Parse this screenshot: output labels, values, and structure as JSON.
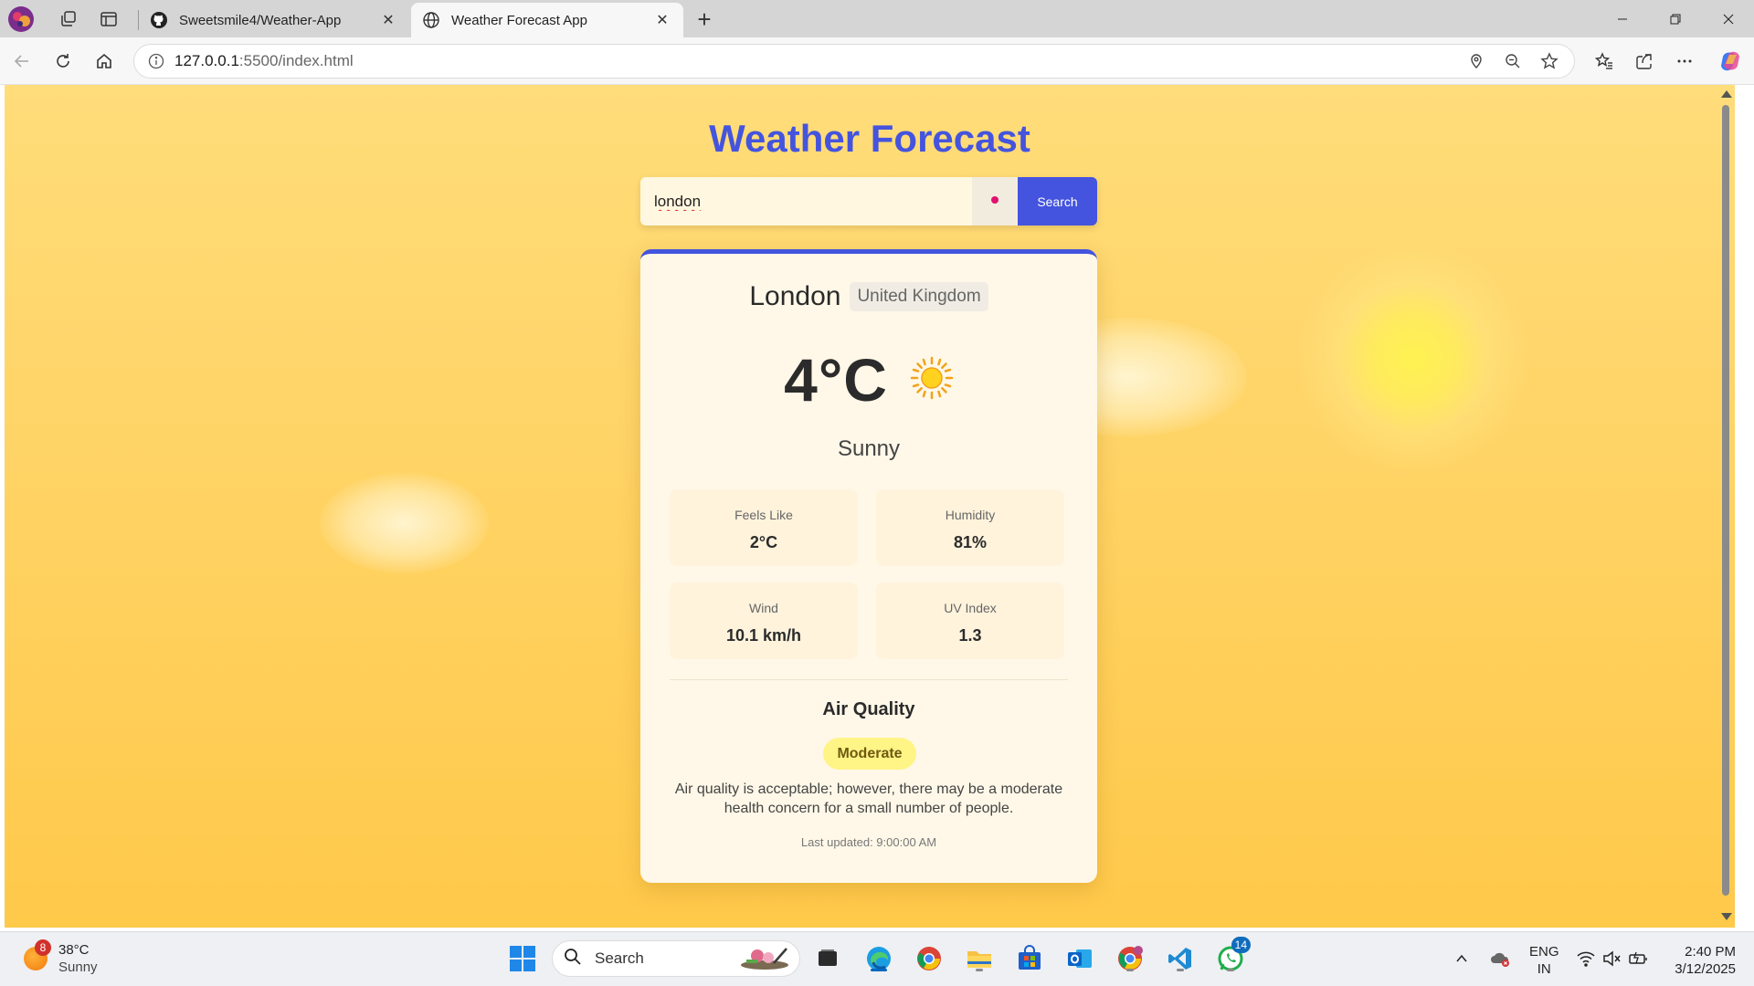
{
  "browser": {
    "tabs": [
      {
        "title": "Sweetsmile4/Weather-App",
        "icon": "github-icon"
      },
      {
        "title": "Weather Forecast App",
        "icon": "globe-icon"
      }
    ],
    "address": {
      "host": "127.0.0.1",
      "path": ":5500/index.html"
    }
  },
  "page": {
    "app_title": "Weather Forecast",
    "search": {
      "value": "london",
      "button_label": "Search"
    },
    "weather": {
      "city": "London",
      "country": "United Kingdom",
      "temperature": "4°C",
      "condition": "Sunny",
      "icon": "sun-icon",
      "stats": [
        {
          "label": "Feels Like",
          "value": "2°C"
        },
        {
          "label": "Humidity",
          "value": "81%"
        },
        {
          "label": "Wind",
          "value": "10.1 km/h"
        },
        {
          "label": "UV Index",
          "value": "1.3"
        }
      ],
      "air_quality": {
        "title": "Air Quality",
        "level": "Moderate",
        "description": "Air quality is acceptable; however, there may be a moderate health concern for a small number of people."
      },
      "last_updated": "Last updated: 9:00:00 AM"
    },
    "colors": {
      "accent": "#4454de",
      "background_top": "#ffdd7a",
      "background_bottom": "#ffc94a",
      "card": "#fff8e8",
      "aq_badge": "#fff486"
    }
  },
  "taskbar": {
    "weather_widget": {
      "temperature": "38°C",
      "condition": "Sunny",
      "badge": "8"
    },
    "search_label": "Search",
    "whatsapp_badge": "14",
    "language": {
      "line1": "ENG",
      "line2": "IN"
    },
    "clock": {
      "time": "2:40 PM",
      "date": "3/12/2025"
    }
  }
}
